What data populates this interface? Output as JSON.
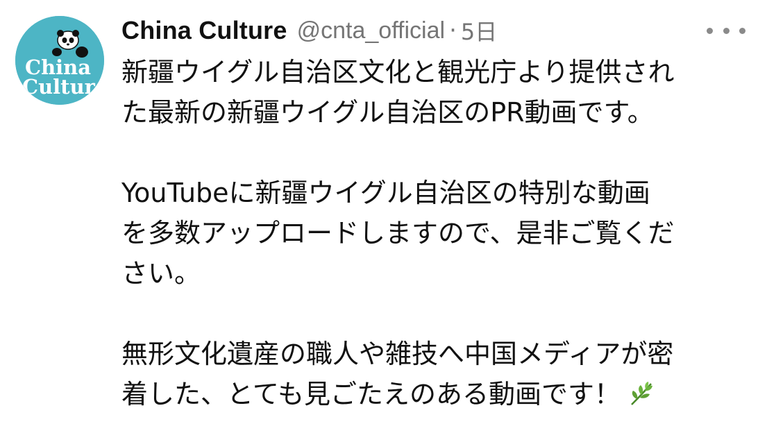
{
  "author": {
    "avatar_text_line1": "China",
    "avatar_text_line2": "Culture",
    "display_name": "China Culture",
    "handle": "@cnta_official",
    "separator": "·",
    "time": "5日"
  },
  "more_icon": "more-horizontal-icon",
  "tweet": {
    "paragraphs": [
      {
        "lines": [
          "新疆ウイグル自治区文化と観光庁より提供され",
          "た最新の新疆ウイグル自治区のPR動画です。"
        ]
      },
      {
        "lines": [
          "YouTubeに新疆ウイグル自治区の特別な動画",
          "を多数アップロードしますので、是非ご覧くだ",
          "さい。"
        ]
      },
      {
        "lines": [
          "無形文化遺産の職人や雑技へ中国メディアが密",
          "着した、とても見ごたえのある動画です！"
        ],
        "emoji": "herb-emoji"
      }
    ]
  },
  "colors": {
    "avatar_bg": "#4db5c5",
    "secondary_text": "#757575",
    "primary_text": "#111111"
  }
}
